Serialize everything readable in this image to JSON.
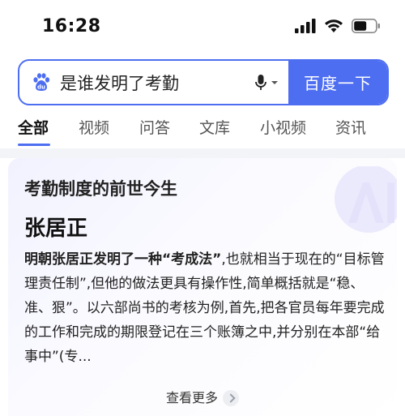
{
  "status_bar": {
    "time": "16:28",
    "icons": [
      "cellular-signal-icon",
      "wifi-icon",
      "battery-icon"
    ]
  },
  "search": {
    "query": "是谁发明了考勤",
    "button_label": "百度一下",
    "logo_icon": "baidu-paw-icon",
    "voice_icon": "microphone-icon"
  },
  "tabs": [
    {
      "label": "全部",
      "active": true
    },
    {
      "label": "视频"
    },
    {
      "label": "问答"
    },
    {
      "label": "文库"
    },
    {
      "label": "小视频"
    },
    {
      "label": "资讯"
    }
  ],
  "card": {
    "kicker": "考勤制度的前世今生",
    "answer": "张居正",
    "body_bold": "明朝张居正发明了一种“考成法”",
    "body_rest": ",也就相当于现在的“目标管理责任制”,但他的做法更具有操作性,简单概括就是“稳、准、狠”。以六部尚书的考核为例,首先,把各官员每年要完成的工作和完成的期限登记在三个账簿之中,并分别在本部“给事中”(专...",
    "more_label": "查看更多"
  },
  "colors": {
    "accent": "#4e6ef2",
    "card_bg": "#f2f2ff",
    "divider": "#f3f4f7"
  }
}
